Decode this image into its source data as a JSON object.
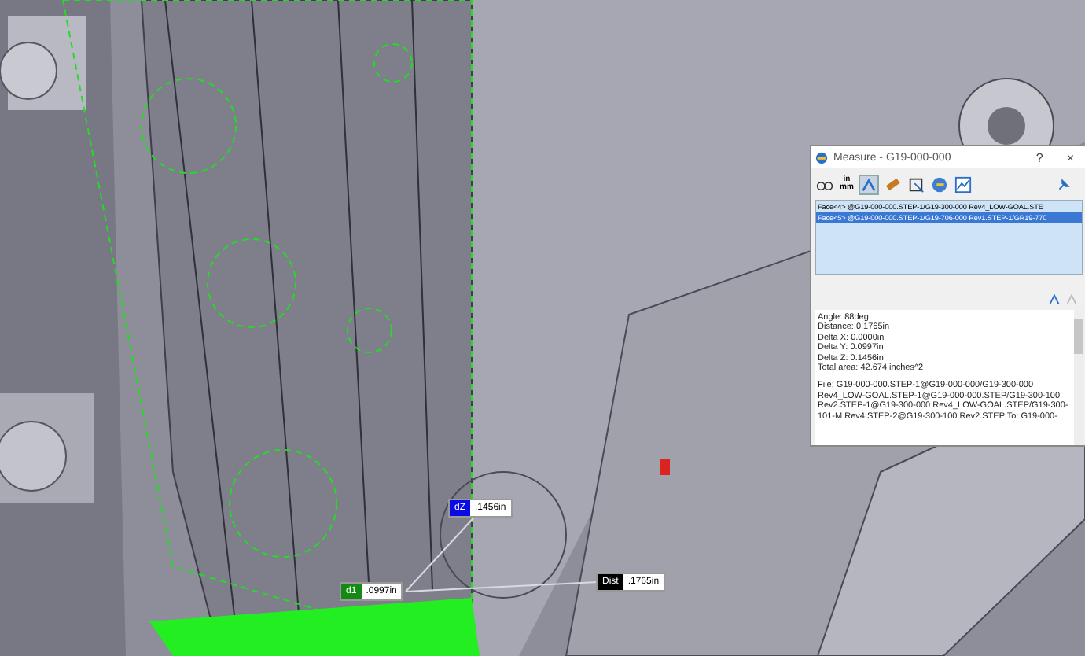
{
  "window": {
    "title": "Measure - G19-000-000",
    "help": "?",
    "close": "×"
  },
  "toolbar": {
    "units_top": "in",
    "units_bottom": "mm"
  },
  "selections": [
    {
      "label": "Face<4> @G19-000-000.STEP-1/G19-300-000 Rev4_LOW-GOAL.STE",
      "selected": false
    },
    {
      "label": "Face<5> @G19-000-000.STEP-1/G19-706-000 Rev1.STEP-1/GR19-770",
      "selected": true
    }
  ],
  "results": [
    "Angle: 88deg",
    "Distance: 0.1765in",
    "Delta X: 0.0000in",
    "Delta Y: 0.0997in",
    "Delta Z: 0.1456in",
    "Total area: 42.674 inches^2"
  ],
  "file_info": "File: G19-000-000.STEP-1@G19-000-000/G19-300-000 Rev4_LOW-GOAL.STEP-1@G19-000-000.STEP/G19-300-100 Rev2.STEP-1@G19-300-000 Rev4_LOW-GOAL.STEP/G19-300-101-M Rev4.STEP-2@G19-300-100 Rev2.STEP To: G19-000-",
  "callouts": [
    {
      "label": "d1",
      "value": ".0997in",
      "color": "#148a14"
    },
    {
      "label": "dZ",
      "value": ".1456in",
      "color": "#0a0ae6"
    },
    {
      "label": "Dist",
      "value": ".1765in",
      "color": "#000000"
    }
  ]
}
